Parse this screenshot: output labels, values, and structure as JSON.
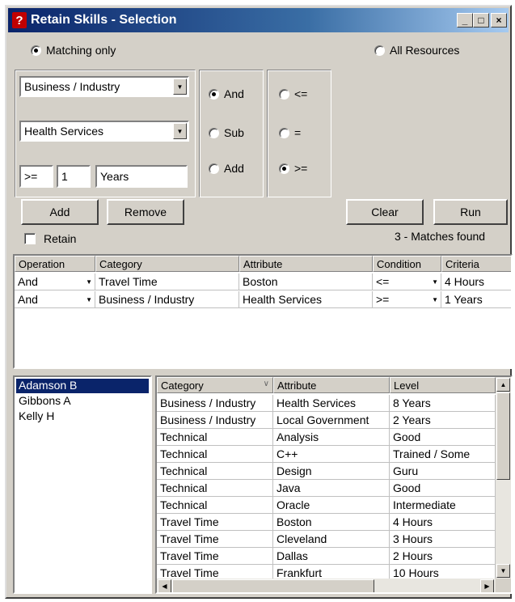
{
  "window": {
    "title": "Retain Skills - Selection",
    "minimize": "_",
    "maximize": "□",
    "close": "×"
  },
  "scope": {
    "matching_only": "Matching only",
    "all_resources": "All Resources",
    "selected": "matching_only"
  },
  "filter": {
    "category": "Business / Industry",
    "attribute": "Health Services",
    "comparator": ">=",
    "value": "1",
    "unit": "Years"
  },
  "operation_radios": [
    {
      "label": "And",
      "selected": true
    },
    {
      "label": "Sub",
      "selected": false
    },
    {
      "label": "Add",
      "selected": false
    }
  ],
  "condition_radios": [
    {
      "label": "<=",
      "selected": false
    },
    {
      "label": "=",
      "selected": false
    },
    {
      "label": ">=",
      "selected": true
    }
  ],
  "buttons": {
    "add": "Add",
    "remove": "Remove",
    "clear": "Clear",
    "run": "Run"
  },
  "retain_label": "Retain",
  "matches_status": "3 - Matches found",
  "criteria_table": {
    "headers": [
      "Operation",
      "Category",
      "Attribute",
      "Condition",
      "Criteria"
    ],
    "rows": [
      [
        "And",
        "Travel Time",
        "Boston",
        "<=",
        "4 Hours"
      ],
      [
        "And",
        "Business / Industry",
        "Health Services",
        ">=",
        "1 Years"
      ]
    ]
  },
  "resources": [
    "Adamson B",
    "Gibbons A",
    "Kelly H"
  ],
  "skills_table": {
    "headers": [
      "Category",
      "Attribute",
      "Level"
    ],
    "rows": [
      [
        "Business / Industry",
        "Health Services",
        "8 Years"
      ],
      [
        "Business / Industry",
        "Local Government",
        "2 Years"
      ],
      [
        "Technical",
        "Analysis",
        "Good"
      ],
      [
        "Technical",
        "C++",
        "Trained / Some"
      ],
      [
        "Technical",
        "Design",
        "Guru"
      ],
      [
        "Technical",
        "Java",
        "Good"
      ],
      [
        "Technical",
        "Oracle",
        "Intermediate"
      ],
      [
        "Travel Time",
        "Boston",
        "4 Hours"
      ],
      [
        "Travel Time",
        "Cleveland",
        "3 Hours"
      ],
      [
        "Travel Time",
        "Dallas",
        "2 Hours"
      ],
      [
        "Travel Time",
        "Frankfurt",
        "10 Hours"
      ]
    ]
  }
}
